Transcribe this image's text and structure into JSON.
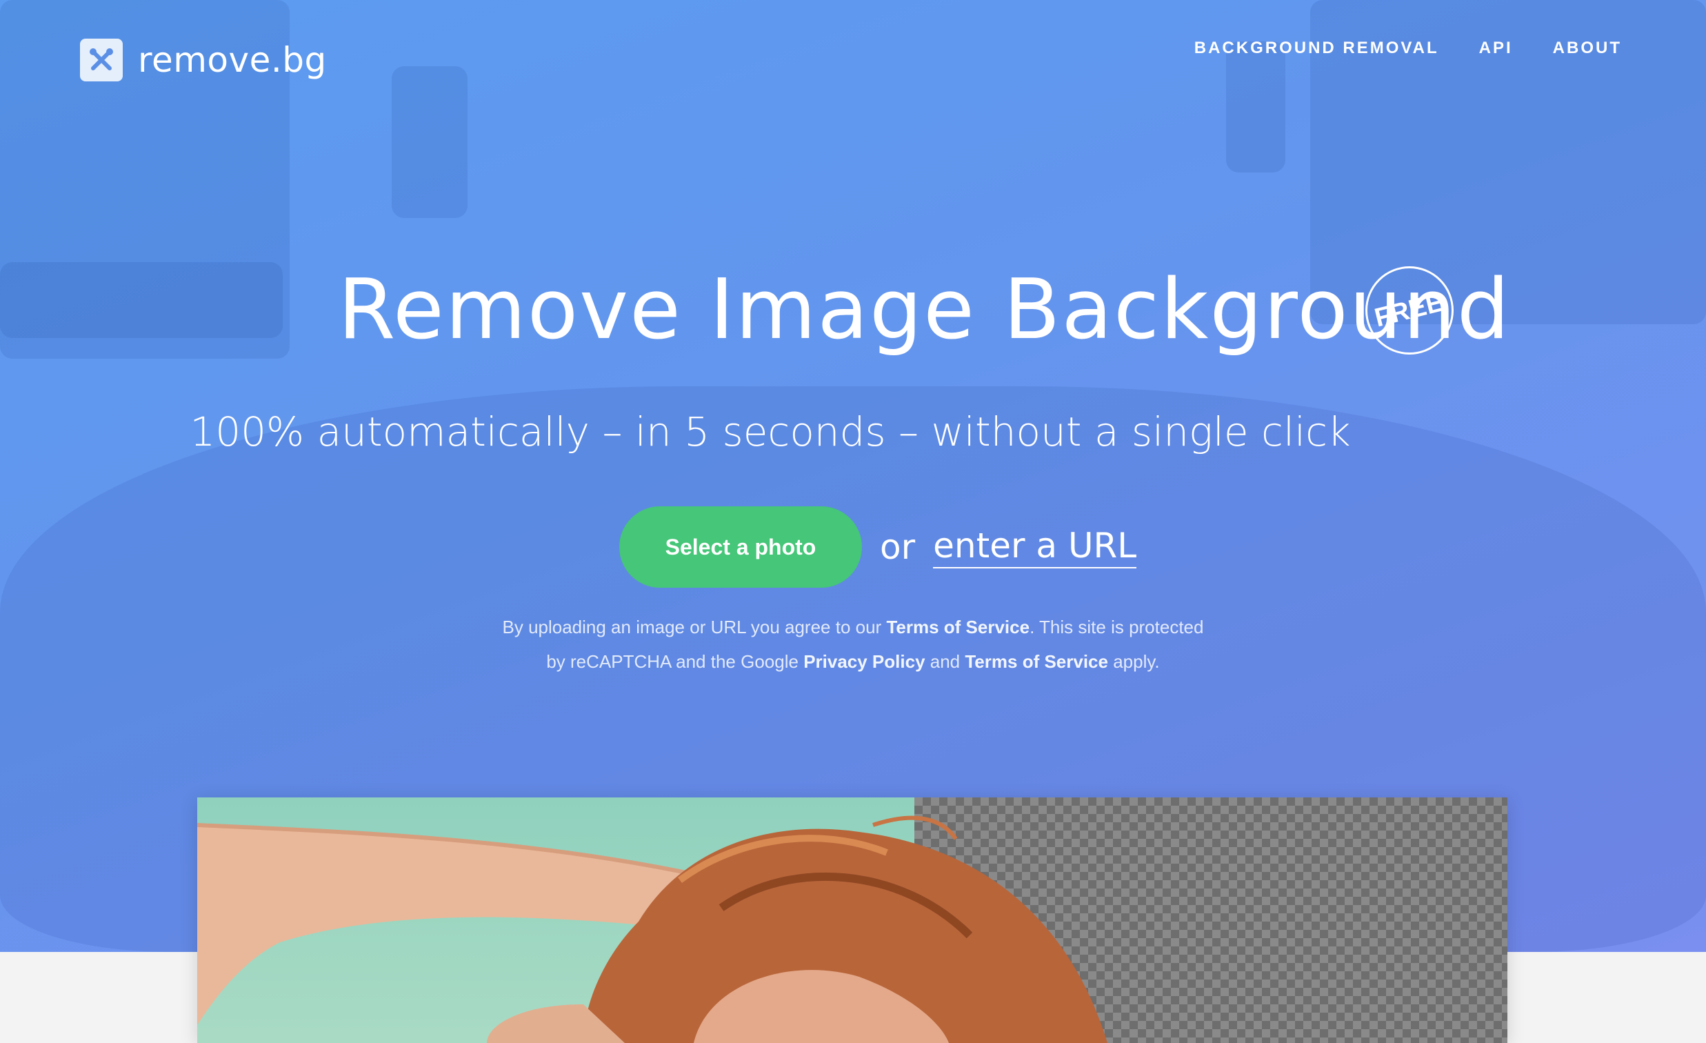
{
  "brand": {
    "name": "remove.bg",
    "logo_icon": "scissors-x-icon"
  },
  "nav": {
    "items": [
      {
        "label": "BACKGROUND REMOVAL"
      },
      {
        "label": "API"
      },
      {
        "label": "ABOUT"
      }
    ]
  },
  "hero": {
    "title": "Remove Image Background",
    "badge": "FREE",
    "subtitle": "100% automatically – in 5 seconds – without a single click",
    "cta_label": "Select a photo",
    "or_text": "or",
    "url_link": "enter a URL",
    "legal": {
      "line1_pre": "By uploading an image or URL you agree to our ",
      "tos_1": "Terms of Service",
      "line1_post": ". This site is protected",
      "line2_pre": "by reCAPTCHA and the Google ",
      "privacy": "Privacy Policy",
      "line2_mid": " and ",
      "tos_2": "Terms of Service",
      "line2_post": " apply."
    }
  },
  "colors": {
    "hero_bg": "#6495ee",
    "cta_green": "#45c678",
    "text": "#ffffff"
  }
}
